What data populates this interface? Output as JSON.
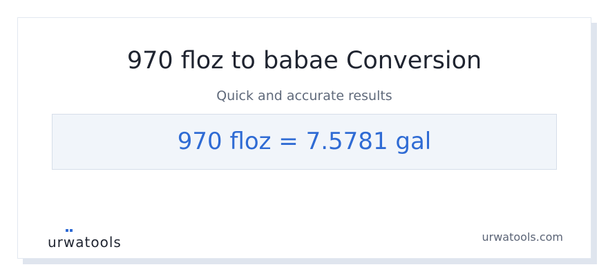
{
  "title": "970 floz to babae Conversion",
  "subtitle": "Quick and accurate results",
  "result": "970 floz = 7.5781 gal",
  "logo": {
    "prefix": "ur",
    "w": "w",
    "suffix": "atools",
    "icon": "glasses-icon"
  },
  "site": "urwatools.com",
  "colors": {
    "title": "#1f2430",
    "subtitle": "#606a7b",
    "result_text": "#2f6bd4",
    "result_bg": "#f1f5fa",
    "logo_accent": "#2f6bd4",
    "site_text": "#5b6476"
  }
}
